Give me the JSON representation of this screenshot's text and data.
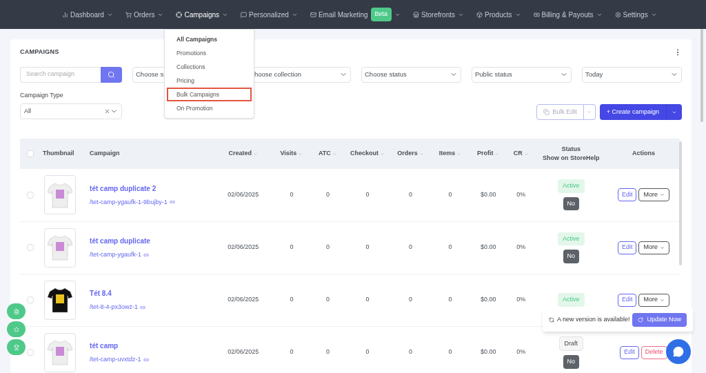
{
  "nav": [
    {
      "label": "Dashboard",
      "expanded": false
    },
    {
      "label": "Orders",
      "expanded": false
    },
    {
      "label": "Campaigns",
      "expanded": true
    },
    {
      "label": "Personalized",
      "expanded": false
    },
    {
      "label": "Email Marketing",
      "badge": "Beta",
      "expanded": false
    },
    {
      "label": "Storefronts",
      "expanded": false
    },
    {
      "label": "Products",
      "expanded": false
    },
    {
      "label": "Billing & Payouts",
      "expanded": false
    },
    {
      "label": "Settings",
      "expanded": false
    }
  ],
  "menu": [
    {
      "label": "All Campaigns",
      "kind": "header",
      "selected": false
    },
    {
      "label": "Promotions",
      "kind": "item",
      "selected": false
    },
    {
      "label": "Collections",
      "kind": "item",
      "selected": false
    },
    {
      "label": "Pricing",
      "kind": "item",
      "selected": false
    },
    {
      "label": "Bulk Campaigns",
      "kind": "item",
      "selected": true
    },
    {
      "label": "On Promotion",
      "kind": "item",
      "selected": false
    }
  ],
  "page_title": "CAMPAIGNS",
  "search": {
    "placeholder": "Search campaign"
  },
  "filters": [
    {
      "value": "Choose s"
    },
    {
      "value": "hoose collection"
    },
    {
      "value": "Choose status"
    },
    {
      "value": "Public status"
    },
    {
      "value": "Today"
    }
  ],
  "campaign_type": {
    "label": "Campaign Type",
    "value": "All"
  },
  "bulk_edit": {
    "label": "Bulk Edit",
    "disabled": true
  },
  "create_button": "+ Create campaign",
  "table": {
    "select_all": {
      "checked": false
    },
    "columns": [
      {
        "label": "Thumbnail",
        "sortable": false
      },
      {
        "label": "Campaign",
        "sortable": false
      },
      {
        "label": "Created",
        "sortable": true
      },
      {
        "label": "Visits",
        "sortable": true
      },
      {
        "label": "ATC",
        "sortable": true
      },
      {
        "label": "Checkout",
        "sortable": true
      },
      {
        "label": "Orders",
        "sortable": true
      },
      {
        "label": "Items",
        "sortable": true
      },
      {
        "label": "Profit",
        "sortable": true
      },
      {
        "label": "CR",
        "sortable": true
      },
      {
        "label": "Status",
        "sublabel": "Show on StoreHelp",
        "sortable": false
      },
      {
        "label": "Actions",
        "sortable": false
      }
    ],
    "rows": [
      {
        "checked": false,
        "thumbnail": {
          "kind": "light"
        },
        "name": "tét camp duplicate 2",
        "slug": "/tet-camp-ygaufk-1-9bujby-1",
        "created": "02/06/2025",
        "visits": "0",
        "atc": "0",
        "checkout": "0",
        "orders": "0",
        "items": "0",
        "profit": "$0.00",
        "cr": "0%",
        "status": {
          "label": "Active",
          "kind": "active"
        },
        "storehelp": "No",
        "actions": [
          {
            "label": "Edit",
            "kind": "edit"
          },
          {
            "label": "More",
            "kind": "more"
          }
        ]
      },
      {
        "checked": false,
        "thumbnail": {
          "kind": "light"
        },
        "name": "tét camp duplicate",
        "slug": "/tet-camp-ygaufk-1",
        "created": "02/06/2025",
        "visits": "0",
        "atc": "0",
        "checkout": "0",
        "orders": "0",
        "items": "0",
        "profit": "$0.00",
        "cr": "0%",
        "status": {
          "label": "Active",
          "kind": "active"
        },
        "storehelp": "No",
        "actions": [
          {
            "label": "Edit",
            "kind": "edit"
          },
          {
            "label": "More",
            "kind": "more"
          }
        ]
      },
      {
        "checked": false,
        "thumbnail": {
          "kind": "dark"
        },
        "name": "Tét 8.4",
        "slug": "/tet-8-4-px3owz-1",
        "created": "02/06/2025",
        "visits": "0",
        "atc": "0",
        "checkout": "0",
        "orders": "0",
        "items": "0",
        "profit": "$0.00",
        "cr": "0%",
        "status": {
          "label": "Active",
          "kind": "active"
        },
        "actions": [
          {
            "label": "Edit",
            "kind": "edit"
          },
          {
            "label": "More",
            "kind": "more"
          }
        ]
      },
      {
        "checked": false,
        "thumbnail": {
          "kind": "light"
        },
        "name": "tét camp",
        "slug": "/tet-camp-uvxtdz-1",
        "created": "02/06/2025",
        "visits": "0",
        "atc": "0",
        "checkout": "0",
        "orders": "0",
        "items": "0",
        "profit": "$0.00",
        "cr": "0%",
        "status": {
          "label": "Draft",
          "kind": "draft"
        },
        "storehelp": "No",
        "actions": [
          {
            "label": "Edit",
            "kind": "edit"
          },
          {
            "label": "Delete",
            "kind": "delete"
          }
        ]
      }
    ]
  },
  "floating_buttons": [
    {
      "kind": "note"
    },
    {
      "kind": "star"
    },
    {
      "kind": "trophy"
    }
  ],
  "toast": {
    "message": "A new version is available!",
    "button": "Update Now"
  }
}
